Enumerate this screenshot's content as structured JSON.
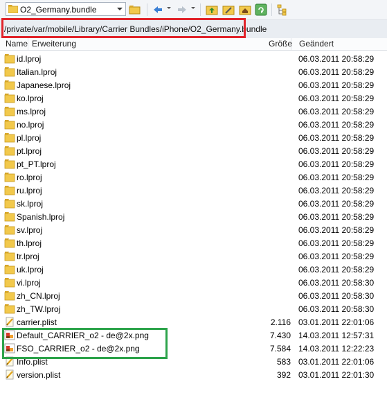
{
  "toolbar": {
    "location_combo": "O2_Germany.bundle"
  },
  "address_bar": {
    "path": "/private/var/mobile/Library/Carrier Bundles/iPhone/O2_Germany.bundle"
  },
  "columns": {
    "name": "Name",
    "extension": "Erweiterung",
    "size": "Größe",
    "modified": "Geändert"
  },
  "files": [
    {
      "name": "id.lproj",
      "size": "",
      "modified": "06.03.2011 20:58:29",
      "type": "folder"
    },
    {
      "name": "Italian.lproj",
      "size": "",
      "modified": "06.03.2011 20:58:29",
      "type": "folder"
    },
    {
      "name": "Japanese.lproj",
      "size": "",
      "modified": "06.03.2011 20:58:29",
      "type": "folder"
    },
    {
      "name": "ko.lproj",
      "size": "",
      "modified": "06.03.2011 20:58:29",
      "type": "folder"
    },
    {
      "name": "ms.lproj",
      "size": "",
      "modified": "06.03.2011 20:58:29",
      "type": "folder"
    },
    {
      "name": "no.lproj",
      "size": "",
      "modified": "06.03.2011 20:58:29",
      "type": "folder"
    },
    {
      "name": "pl.lproj",
      "size": "",
      "modified": "06.03.2011 20:58:29",
      "type": "folder"
    },
    {
      "name": "pt.lproj",
      "size": "",
      "modified": "06.03.2011 20:58:29",
      "type": "folder"
    },
    {
      "name": "pt_PT.lproj",
      "size": "",
      "modified": "06.03.2011 20:58:29",
      "type": "folder"
    },
    {
      "name": "ro.lproj",
      "size": "",
      "modified": "06.03.2011 20:58:29",
      "type": "folder"
    },
    {
      "name": "ru.lproj",
      "size": "",
      "modified": "06.03.2011 20:58:29",
      "type": "folder"
    },
    {
      "name": "sk.lproj",
      "size": "",
      "modified": "06.03.2011 20:58:29",
      "type": "folder"
    },
    {
      "name": "Spanish.lproj",
      "size": "",
      "modified": "06.03.2011 20:58:29",
      "type": "folder"
    },
    {
      "name": "sv.lproj",
      "size": "",
      "modified": "06.03.2011 20:58:29",
      "type": "folder"
    },
    {
      "name": "th.lproj",
      "size": "",
      "modified": "06.03.2011 20:58:29",
      "type": "folder"
    },
    {
      "name": "tr.lproj",
      "size": "",
      "modified": "06.03.2011 20:58:29",
      "type": "folder"
    },
    {
      "name": "uk.lproj",
      "size": "",
      "modified": "06.03.2011 20:58:29",
      "type": "folder"
    },
    {
      "name": "vi.lproj",
      "size": "",
      "modified": "06.03.2011 20:58:30",
      "type": "folder"
    },
    {
      "name": "zh_CN.lproj",
      "size": "",
      "modified": "06.03.2011 20:58:30",
      "type": "folder"
    },
    {
      "name": "zh_TW.lproj",
      "size": "",
      "modified": "06.03.2011 20:58:30",
      "type": "folder"
    },
    {
      "name": "carrier.plist",
      "size": "2.116",
      "modified": "03.01.2011 22:01:06",
      "type": "plist"
    },
    {
      "name": "Default_CARRIER_o2 - de@2x.png",
      "size": "7.430",
      "modified": "14.03.2011 12:57:31",
      "type": "png"
    },
    {
      "name": "FSO_CARRIER_o2 - de@2x.png",
      "size": "7.584",
      "modified": "14.03.2011 12:22:23",
      "type": "png"
    },
    {
      "name": "Info.plist",
      "size": "583",
      "modified": "03.01.2011 22:01:06",
      "type": "plist"
    },
    {
      "name": "version.plist",
      "size": "392",
      "modified": "03.01.2011 22:01:30",
      "type": "plist"
    }
  ],
  "colors": {
    "highlight_red": "#e1232a",
    "highlight_green": "#2ca34a",
    "folder_yellow": "#f2c94c"
  }
}
